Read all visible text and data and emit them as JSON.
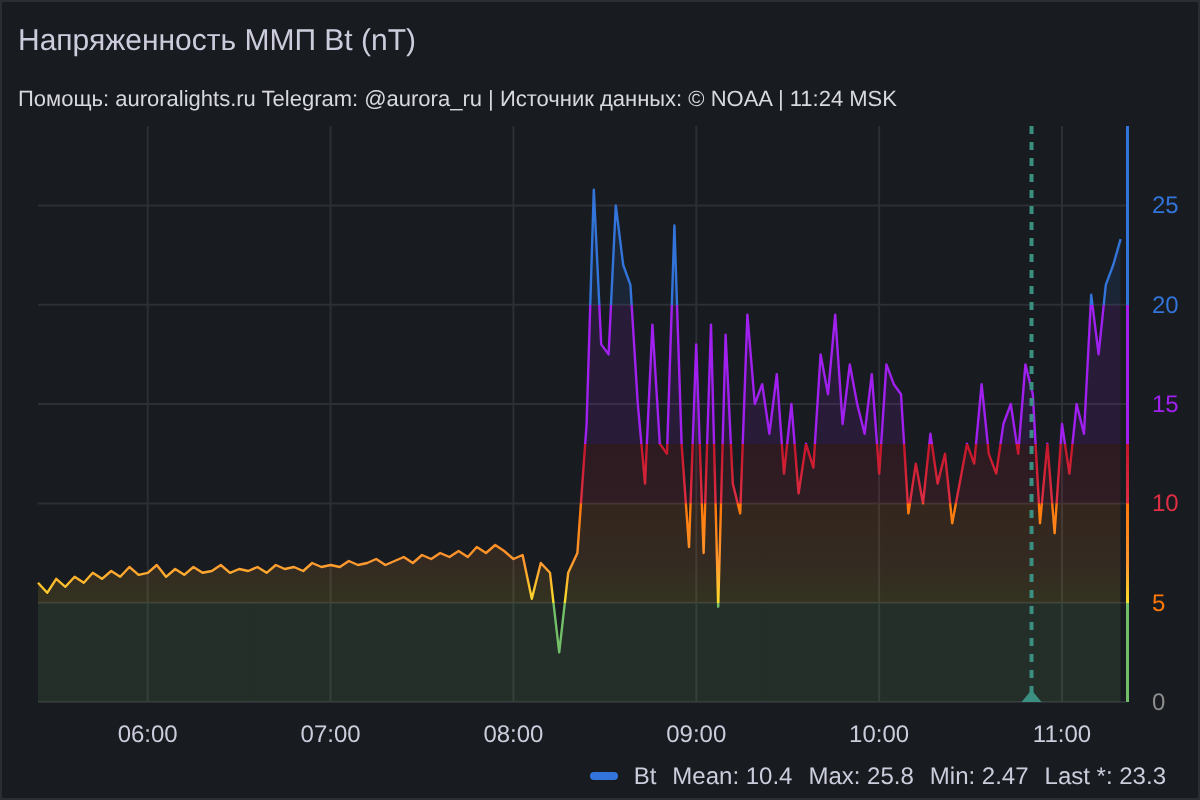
{
  "panel": {
    "title": "Напряженность ММП Bt (nT)",
    "subtitle": "Помощь: auroralights.ru Telegram: @aurora_ru | Источник данных:  © NOAA | 11:24 MSK"
  },
  "chart_data": {
    "type": "area",
    "grid": true,
    "xlim": [
      324,
      681
    ],
    "ylim": [
      0,
      29
    ],
    "xticks": [
      {
        "value": 360,
        "label": "06:00"
      },
      {
        "value": 420,
        "label": "07:00"
      },
      {
        "value": 480,
        "label": "08:00"
      },
      {
        "value": 540,
        "label": "09:00"
      },
      {
        "value": 600,
        "label": "10:00"
      },
      {
        "value": 660,
        "label": "11:00"
      }
    ],
    "yticks": [
      0,
      5,
      10,
      15,
      20,
      25
    ],
    "x": [
      324,
      327,
      330,
      333,
      336,
      339,
      342,
      345,
      348,
      351,
      354,
      357,
      360,
      363,
      366,
      369,
      372,
      375,
      378,
      381,
      384,
      387,
      390,
      393,
      396,
      399,
      402,
      405,
      408,
      411,
      414,
      417,
      420,
      423,
      426,
      429,
      432,
      435,
      438,
      441,
      444,
      447,
      450,
      453,
      456,
      459,
      462,
      465,
      468,
      471,
      474,
      477,
      480,
      483,
      486,
      489,
      492,
      495,
      498,
      501,
      504,
      506.4,
      508.8,
      511.2,
      513.6,
      516,
      518.4,
      520.8,
      523.2,
      525.6,
      528,
      530.4,
      532.8,
      535.2,
      537.6,
      540,
      542.4,
      544.8,
      547.2,
      549.6,
      552,
      554.4,
      556.8,
      559.2,
      561.6,
      564,
      566.4,
      568.8,
      571.2,
      573.6,
      576,
      578.4,
      580.8,
      583.2,
      585.6,
      588,
      590.4,
      592.8,
      595.2,
      597.6,
      600,
      602.4,
      604.8,
      607.2,
      609.6,
      612,
      614.4,
      616.8,
      619.2,
      621.6,
      624,
      626.4,
      628.8,
      631.2,
      633.6,
      636,
      638.4,
      640.8,
      643.2,
      645.6,
      648,
      650.4,
      652.8,
      655.2,
      657.6,
      660,
      662.4,
      664.8,
      667.2,
      669.6,
      672,
      674.4,
      676.8,
      679.2
    ],
    "series": [
      {
        "name": "Bt",
        "color": "#3274d9",
        "values": [
          6,
          5.5,
          6.2,
          5.8,
          6.3,
          6.0,
          6.5,
          6.2,
          6.6,
          6.3,
          6.8,
          6.4,
          6.5,
          6.9,
          6.3,
          6.7,
          6.4,
          6.8,
          6.5,
          6.6,
          6.9,
          6.5,
          6.7,
          6.6,
          6.8,
          6.5,
          6.9,
          6.7,
          6.8,
          6.6,
          7.0,
          6.8,
          6.9,
          6.8,
          7.1,
          6.9,
          7.0,
          7.2,
          6.9,
          7.1,
          7.3,
          7.0,
          7.4,
          7.2,
          7.5,
          7.3,
          7.6,
          7.3,
          7.8,
          7.5,
          7.9,
          7.6,
          7.2,
          7.4,
          5.2,
          7.0,
          6.5,
          2.5,
          6.5,
          7.5,
          14,
          25.8,
          18,
          17.5,
          25,
          22,
          21,
          15,
          11,
          19,
          13,
          12.5,
          24,
          13,
          7.8,
          18,
          7.5,
          19,
          4.8,
          18.5,
          11,
          9.5,
          19.5,
          15,
          16,
          13.5,
          16.5,
          11.5,
          15,
          10.5,
          13,
          11.8,
          17.5,
          15.5,
          19.5,
          14,
          17,
          15,
          13.5,
          16.5,
          11.5,
          17,
          16,
          15.5,
          9.5,
          12,
          10,
          13.5,
          11,
          12.5,
          9,
          11,
          13,
          12,
          16,
          12.5,
          11.5,
          14,
          15,
          12.5,
          17,
          15.5,
          9,
          13,
          8.5,
          14,
          11.5,
          15,
          13.5,
          20.5,
          17.5,
          21,
          22,
          23.3
        ]
      }
    ],
    "ref_lines": [
      {
        "axis": "x",
        "value": 650,
        "color": "#3a8f80"
      }
    ]
  },
  "legend_stats": [
    "Mean: 10.4",
    "Max: 25.8",
    "Min: 2.47",
    "Last *: 23.3"
  ]
}
